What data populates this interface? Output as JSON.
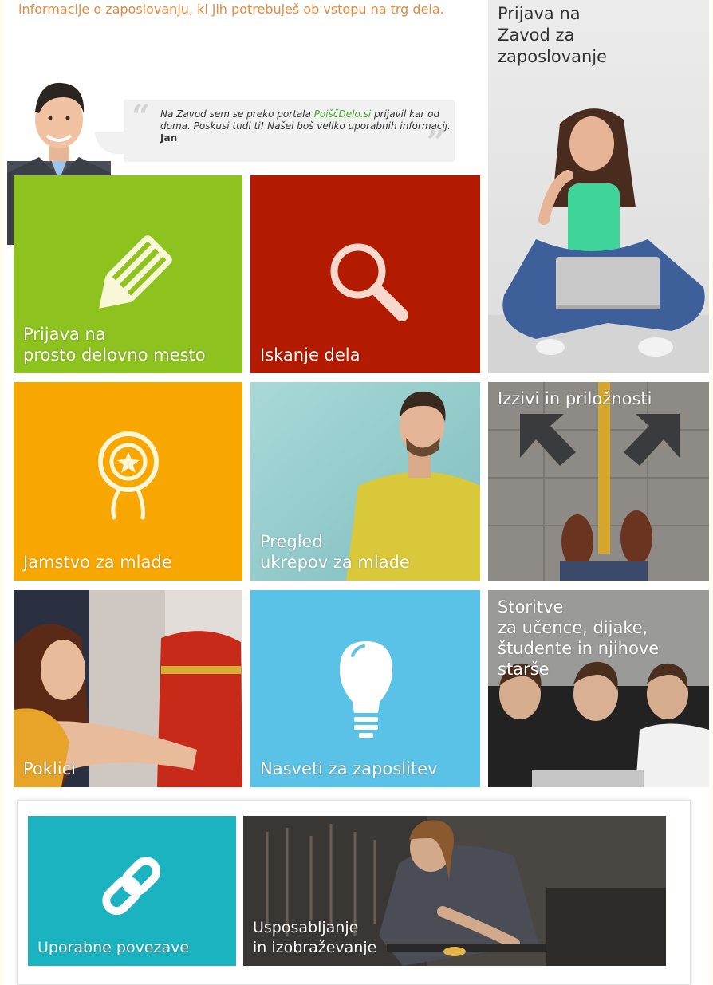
{
  "intro": {
    "text": "informacije o zaposlovanju, ki jih potrebuješ ob vstopu na trg dela."
  },
  "testimonial": {
    "text_before": "Na Zavod sem se preko portala ",
    "link": "PoiščDelo.si",
    "text_after": " prijavil kar od doma. Poskusi tudi ti! Našel boš veliko uporabnih informacij. ",
    "author": "Jan"
  },
  "tiles": {
    "prijava_zavod": {
      "label": "Prijava na\nZavod za\nzaposlovanje"
    },
    "prosto_mesto": {
      "label": "Prijava na\nprosto delovno mesto",
      "color": "#8dc21f"
    },
    "iskanje": {
      "label": "Iskanje dela",
      "color": "#b31b00"
    },
    "jamstvo": {
      "label": "Jamstvo za mlade",
      "color": "#f7a700"
    },
    "pregled": {
      "label": "Pregled\nukrepov za mlade"
    },
    "izzivi": {
      "label": "Izzivi in priložnosti"
    },
    "poklici": {
      "label": "Poklici"
    },
    "nasveti": {
      "label": "Nasveti za zaposlitev",
      "color": "#5bc2e7"
    },
    "storitve": {
      "label": "Storitve\nza učence, dijake,\nštudente in njihove\nstarše"
    },
    "povezave": {
      "label": "Uporabne povezave",
      "color": "#1ab3bf"
    },
    "usposabljanje": {
      "label": "Usposabljanje\nin izobraževanje"
    }
  }
}
